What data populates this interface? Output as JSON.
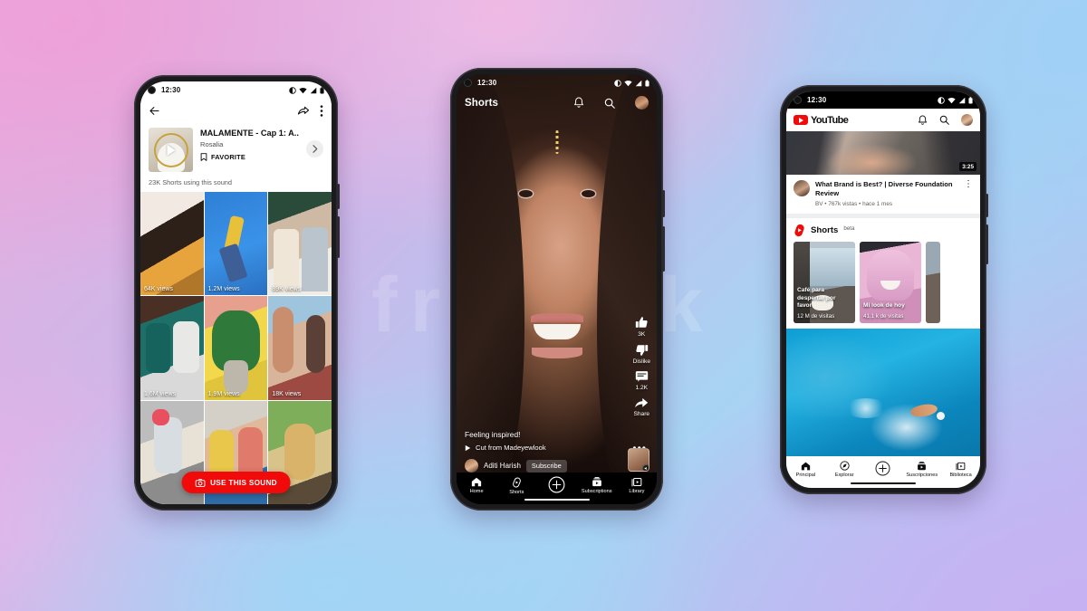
{
  "background": {
    "watermark_text": "freepik",
    "accent_red": "#f00a0a",
    "gradient_colors": [
      "#e9aede",
      "#c9b8ea",
      "#a8d3f3",
      "#c2b4ef"
    ]
  },
  "phone1": {
    "status": {
      "time": "12:30",
      "icons": [
        "dnd-icon",
        "wifi-icon",
        "signal-icon",
        "battery-icon"
      ]
    },
    "actionbar": {
      "back": "back-arrow-icon",
      "share": "share-arrow-icon",
      "menu": "more-vertical-icon"
    },
    "sound": {
      "title": "MALAMENTE - Cap 1: A...",
      "artist": "Rosalia",
      "favorite_label": "FAVORITE",
      "favorite_icon": "bookmark-icon",
      "chevron_icon": "chevron-right-icon",
      "play_icon": "play-icon",
      "using_count": "23K Shorts using this sound"
    },
    "cta": {
      "label": "USE THIS SOUND",
      "icon": "camera-icon"
    },
    "grid": [
      {
        "views": "64K views",
        "alt": "two friends celebrating with confetti"
      },
      {
        "views": "1.2M views",
        "alt": "woman jumping in yellow jacket on blue tiles"
      },
      {
        "views": "89K views",
        "alt": "two men pouring drinks in a cafe"
      },
      {
        "views": "1.6M views",
        "alt": "two people laughing on a couch"
      },
      {
        "views": "1.9M views",
        "alt": "person holding a large monstera plant"
      },
      {
        "views": "18K views",
        "alt": "two women stretching outdoors"
      },
      {
        "views": "",
        "alt": "child on a scooter"
      },
      {
        "views": "",
        "alt": "two friends smiling outside"
      },
      {
        "views": "",
        "alt": "golden retriever on a skateboard"
      }
    ]
  },
  "phone2": {
    "status": {
      "time": "12:30",
      "icons": [
        "dnd-icon",
        "wifi-icon",
        "signal-icon",
        "battery-icon"
      ]
    },
    "header": {
      "title": "Shorts",
      "bell_icon": "bell-icon",
      "search_icon": "search-icon",
      "avatar": "avatar"
    },
    "rail": [
      {
        "icon": "thumbs-up-icon",
        "label": "3K"
      },
      {
        "icon": "thumbs-down-icon",
        "label": "Dislike"
      },
      {
        "icon": "comment-icon",
        "label": "1.2K"
      },
      {
        "icon": "share-icon",
        "label": "Share"
      }
    ],
    "overlay": {
      "caption": "Feeling inspired!",
      "sound_label": "Cut from Madeyewlook",
      "sound_icon": "play-icon",
      "channel_name": "Aditi Harish",
      "subscribe_label": "Subscribe",
      "more_icon": "more-horizontal-icon",
      "thumbnail_alt": "creator thumbnail"
    },
    "nav": [
      {
        "label": "Home",
        "icon": "home-icon"
      },
      {
        "label": "Shorts",
        "icon": "shorts-icon"
      },
      {
        "label": "",
        "icon": "plus-circle-icon"
      },
      {
        "label": "Subscriptions",
        "icon": "subscriptions-icon"
      },
      {
        "label": "Library",
        "icon": "library-icon"
      }
    ]
  },
  "phone3": {
    "status": {
      "time": "12:30",
      "icons": [
        "dnd-icon",
        "wifi-icon",
        "signal-icon",
        "battery-icon"
      ]
    },
    "header": {
      "logo_word": "YouTube",
      "bell_icon": "bell-icon",
      "search_icon": "search-icon",
      "avatar": "avatar"
    },
    "video": {
      "duration": "3:25",
      "title": "What Brand is Best? | Diverse Foundation Review",
      "meta": "BV • 767k vistas • hace 1 mes",
      "menu_icon": "more-vertical-icon",
      "thumbnail_alt": "woman in a car"
    },
    "shorts_shelf": {
      "title": "Shorts",
      "badge": "beta",
      "logo_icon": "shorts-icon",
      "cards": [
        {
          "title": "Café para despertar por favor",
          "views": "12 M de visitas",
          "alt": "hand holding coffee cup by a window"
        },
        {
          "title": "Mi look de hoy",
          "views": "41.1 k de visitas",
          "alt": "woman with pink hair laughing"
        },
        {
          "title": "",
          "views": "",
          "alt": "city view"
        }
      ]
    },
    "feed_video": {
      "alt": "swimmer in a blue pool"
    },
    "nav": [
      {
        "label": "Principal",
        "icon": "home-icon"
      },
      {
        "label": "Explorar",
        "icon": "compass-icon"
      },
      {
        "label": "",
        "icon": "plus-circle-icon"
      },
      {
        "label": "Suscripciones",
        "icon": "subscriptions-icon"
      },
      {
        "label": "Biblioteca",
        "icon": "library-icon"
      }
    ]
  }
}
